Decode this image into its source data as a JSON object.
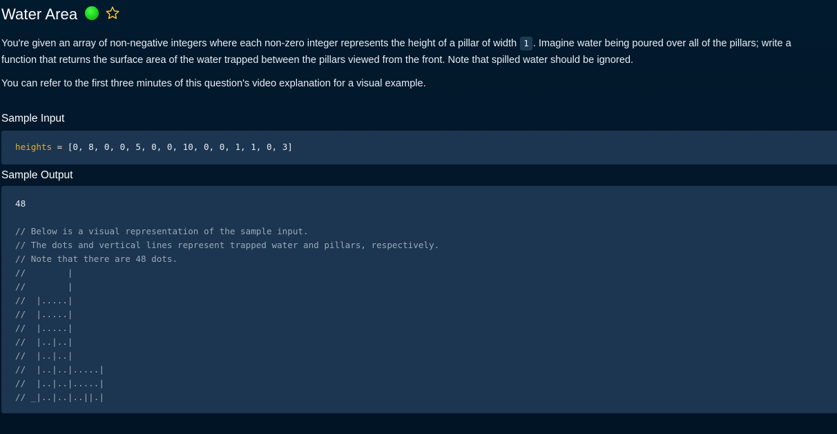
{
  "header": {
    "title": "Water Area",
    "status_color": "#1ccf1c",
    "status_icon": "completed-dot-icon",
    "star_icon": "star-outline-icon",
    "star_color": "#f5c542"
  },
  "description": {
    "p1_before": "You're given an array of non-negative integers where each non-zero integer represents the height of a pillar of width ",
    "p1_code": "1",
    "p1_after": ". Imagine water being poured over all of the pillars; write a function that returns the surface area of the water trapped between the pillars viewed from the front. Note that spilled water should be ignored.",
    "p2": "You can refer to the first three minutes of this question's video explanation for a visual example."
  },
  "sample_input": {
    "heading": "Sample Input",
    "var": "heights",
    "rest": " = [0, 8, 0, 0, 5, 0, 0, 10, 0, 0, 1, 1, 0, 3]"
  },
  "sample_output": {
    "heading": "Sample Output",
    "value": "48",
    "comments": [
      "// Below is a visual representation of the sample input.",
      "// The dots and vertical lines represent trapped water and pillars, respectively.",
      "// Note that there are 48 dots.",
      "//        |",
      "//        |",
      "//  |.....|",
      "//  |.....|",
      "//  |.....|",
      "//  |..|..|",
      "//  |..|..|",
      "//  |..|..|.....|",
      "//  |..|..|.....|",
      "// _|..|..|..||.|"
    ]
  }
}
